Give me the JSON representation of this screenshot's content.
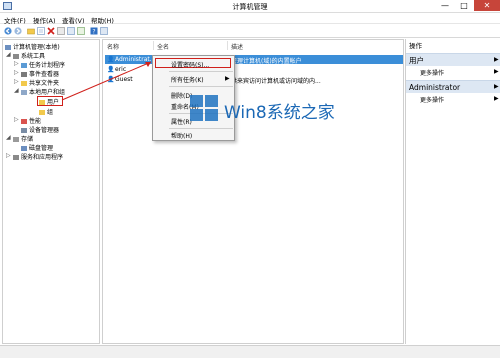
{
  "window": {
    "title": "计算机管理",
    "minimize_glyph": "—",
    "maximize_glyph": "□",
    "close_glyph": "✕"
  },
  "menu": [
    "文件(F)",
    "操作(A)",
    "查看(V)",
    "帮助(H)"
  ],
  "toolbar": {
    "icons": [
      "back-arrow-icon",
      "forward-arrow-icon",
      "folder-icon",
      "list-icon",
      "delete-icon",
      "properties-icon",
      "refresh-icon",
      "export-icon",
      "help-icon",
      "mmc-icon"
    ]
  },
  "tree": {
    "root": "计算机管理(本地)",
    "system_tools": "系统工具",
    "task_scheduler": "任务计划程序",
    "event_viewer": "事件查看器",
    "shared_folders": "共享文件夹",
    "local_users_groups": "本地用户和组",
    "users": "用户",
    "groups": "组",
    "performance": "性能",
    "device_manager": "设备管理器",
    "storage": "存储",
    "disk_management": "磁盘管理",
    "services_apps": "服务和应用程序"
  },
  "list": {
    "columns": {
      "name": "名称",
      "fullname": "全名",
      "description": "描述"
    },
    "rows": [
      {
        "name": "Administrat...",
        "fullname": "",
        "description": "管理计算机(域)的内置帐户"
      },
      {
        "name": "eric",
        "fullname": "",
        "description": ""
      },
      {
        "name": "Guest",
        "fullname": "",
        "description": "供来宾访问计算机或访问域的内..."
      }
    ]
  },
  "context_menu": {
    "set_password": "设置密码(S)...",
    "all_tasks": "所有任务(K)",
    "delete": "删除(D)",
    "rename": "重命名(M)",
    "properties": "属性(R)",
    "help": "帮助(H)",
    "submenu_arrow": "▶"
  },
  "actions": {
    "header": "操作",
    "sections": [
      {
        "title": "用户",
        "more": "更多操作"
      },
      {
        "title": "Administrator",
        "more": "更多操作"
      }
    ],
    "arrow": "▶"
  },
  "watermark": {
    "text": "Win8系统之家"
  },
  "colors": {
    "selection": "#3b8ed8",
    "highlight_box": "#d0201b",
    "action_section": "#dde7f3",
    "close_button": "#c7453a"
  }
}
